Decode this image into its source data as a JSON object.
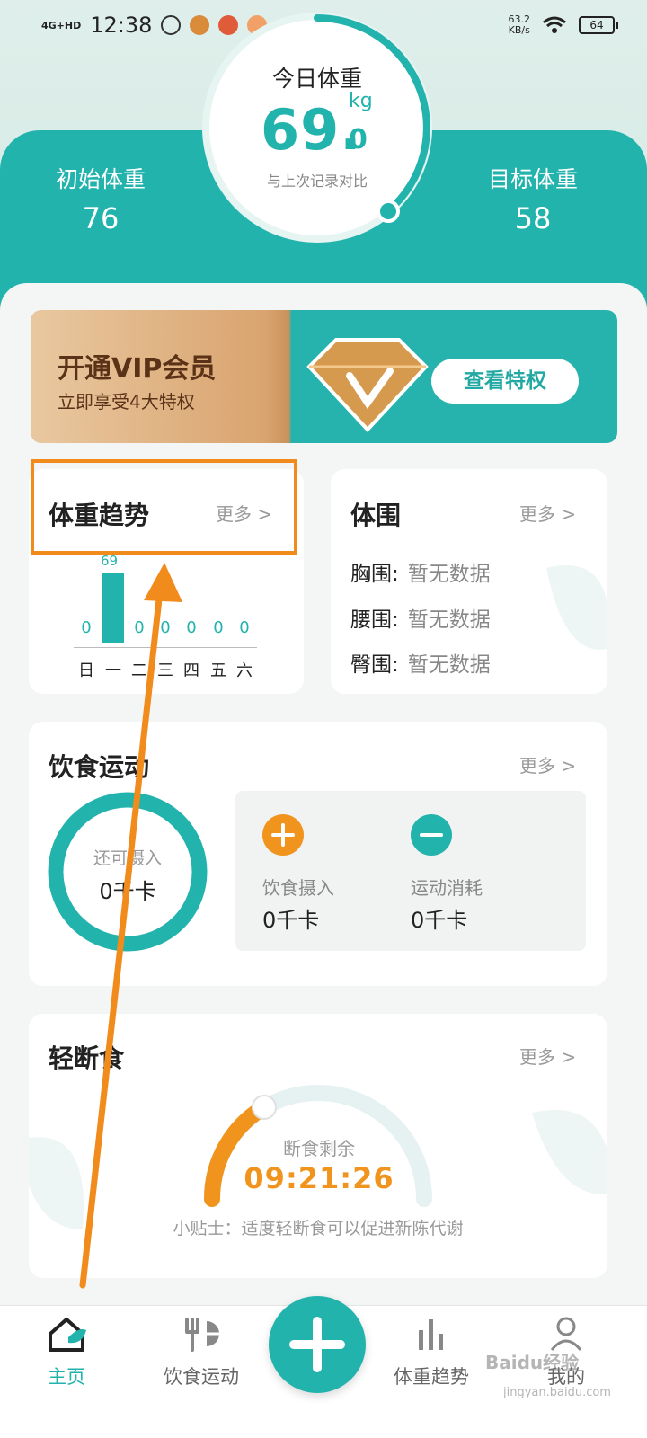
{
  "status_bar": {
    "network": "4G+HD",
    "time": "12:38",
    "speed_value": "63.2",
    "speed_unit": "KB/s",
    "battery": "64"
  },
  "weight": {
    "today_label": "今日体重",
    "today_integer": "69.",
    "today_decimal": "0",
    "unit": "kg",
    "compare_text": "与上次记录对比",
    "initial_label": "初始体重",
    "initial_value": "76",
    "target_label": "目标体重",
    "target_value": "58"
  },
  "vip": {
    "title": "开通VIP会员",
    "subtitle": "立即享受4大特权",
    "button": "查看特权"
  },
  "trend": {
    "title": "体重趋势",
    "more": "更多 >",
    "chart_data": {
      "type": "bar",
      "categories": [
        "日",
        "一",
        "二",
        "三",
        "四",
        "五",
        "六"
      ],
      "values": [
        0,
        69,
        0,
        0,
        0,
        0,
        0
      ]
    },
    "top_label": "69",
    "value_labels": [
      "0",
      "0",
      "0",
      "0",
      "0",
      "0"
    ]
  },
  "girth": {
    "title": "体围",
    "more": "更多 >",
    "rows": [
      {
        "label": "胸围:",
        "value": "暂无数据"
      },
      {
        "label": "腰围:",
        "value": "暂无数据"
      },
      {
        "label": "臀围:",
        "value": "暂无数据"
      }
    ]
  },
  "diet": {
    "title": "饮食运动",
    "more": "更多 >",
    "remain_label": "还可摄入",
    "remain_value": "0千卡",
    "intake_label": "饮食摄入",
    "intake_value": "0千卡",
    "burn_label": "运动消耗",
    "burn_value": "0千卡"
  },
  "fasting": {
    "title": "轻断食",
    "more": "更多 >",
    "remain_label": "断食剩余",
    "remain_time": "09:21:26",
    "tip": "小贴士：适度轻断食可以促进新陈代谢"
  },
  "nav": {
    "home": "主页",
    "diet": "饮食运动",
    "trend": "体重趋势",
    "mine": "我的"
  },
  "watermark": {
    "brand": "Baidu经验",
    "url": "jingyan.baidu.com"
  },
  "colors": {
    "teal": "#23b3ad",
    "orange": "#f0941d",
    "annotation": "#f08b1c"
  }
}
